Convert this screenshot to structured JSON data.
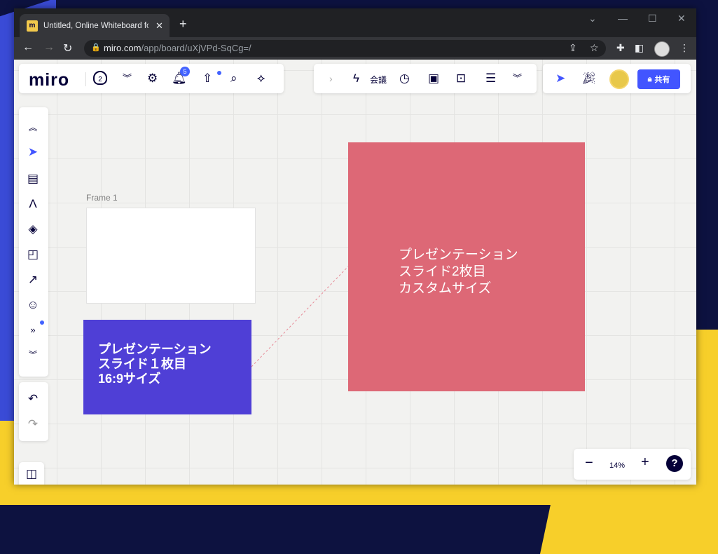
{
  "browser": {
    "tab_title": "Untitled, Online Whiteboard for \\",
    "url_host": "miro.com",
    "url_path": "/app/board/uXjVPd-SqCg=/"
  },
  "toolbar": {
    "logo": "miro",
    "plan_badge": "2",
    "notifications_count": "5",
    "meeting_label": "会議",
    "share_label": "共有"
  },
  "board": {
    "frame_label": "Frame 1",
    "slide1_text": "プレゼンテーション\nスライド１枚目\n16:9サイズ",
    "slide2_text": "プレゼンテーション\nスライド2枚目\nカスタムサイズ",
    "slide1_color": "#4f3fd6",
    "slide2_color": "#dd6876"
  },
  "zoom": {
    "level": "14%"
  },
  "icons": [
    "search-icon",
    "settings-icon",
    "notifications-icon",
    "upload-icon",
    "plugin-icon",
    "timer-icon",
    "select-icon",
    "comment-icon",
    "pen-icon",
    "shapes-icon",
    "sticky-note-icon",
    "arrow-icon",
    "emoji-icon",
    "undo-icon",
    "redo-icon",
    "help-icon"
  ]
}
